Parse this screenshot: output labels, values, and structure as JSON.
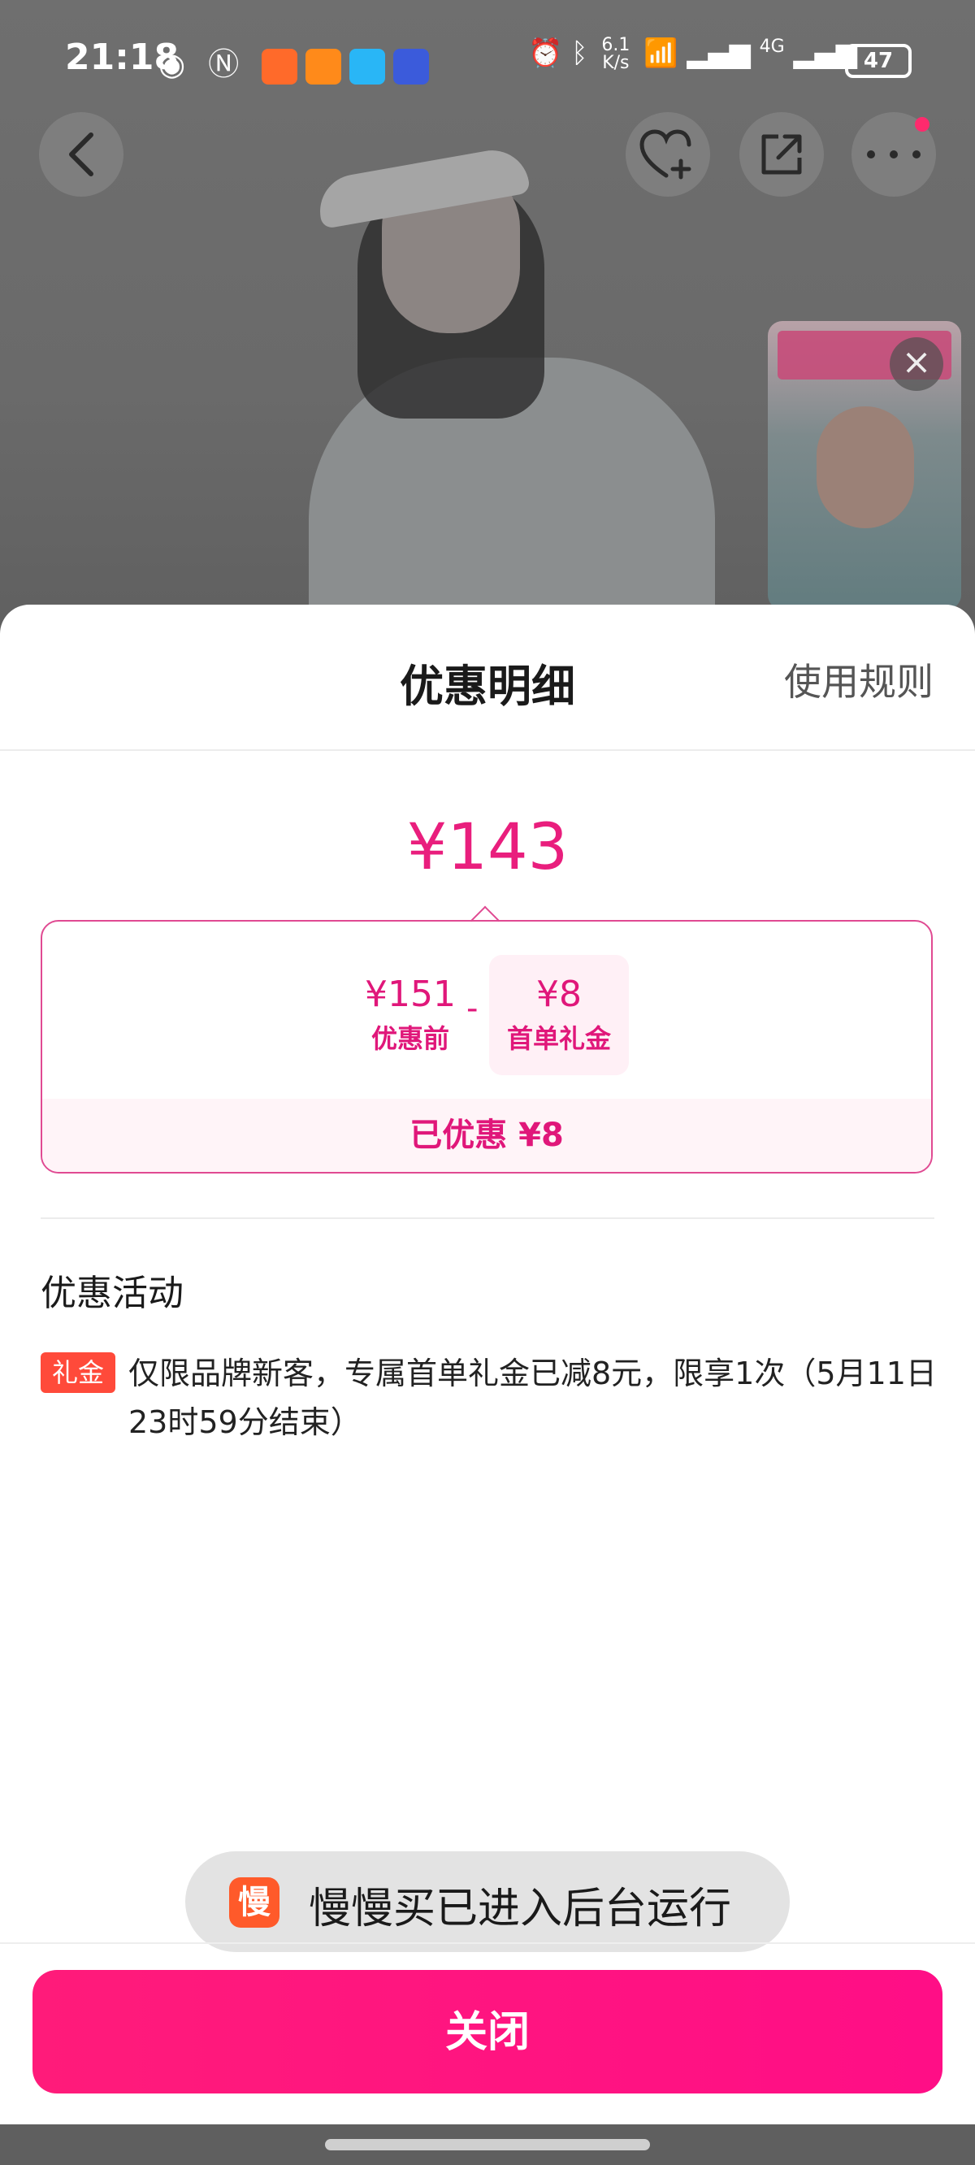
{
  "status_bar": {
    "time": "21:18",
    "net_speed_value": "6.1",
    "net_speed_unit": "K/s",
    "network": "4G",
    "battery": "47"
  },
  "top_controls": {
    "back": "back-icon",
    "favorite": "heart-plus-icon",
    "share": "share-icon",
    "more": "more-icon"
  },
  "sheet": {
    "title": "优惠明细",
    "rules_link": "使用规则",
    "final_price": "¥143",
    "breakdown": {
      "original_value": "¥151",
      "original_label": "优惠前",
      "operator": "-",
      "discount_value": "¥8",
      "discount_label": "首单礼金",
      "saved_text": "已优惠 ¥8"
    },
    "activities_title": "优惠活动",
    "activity": {
      "tag": "礼金",
      "text": "仅限品牌新客，专属首单礼金已减8元，限享1次（5月11日23时59分结束）"
    },
    "close_button": "关闭"
  },
  "toast": {
    "icon_char": "慢",
    "text": "慢慢买已进入后台运行"
  },
  "colors": {
    "accent": "#e91e7d",
    "button": "#ff1b7a",
    "tag": "#ff4a3a"
  }
}
